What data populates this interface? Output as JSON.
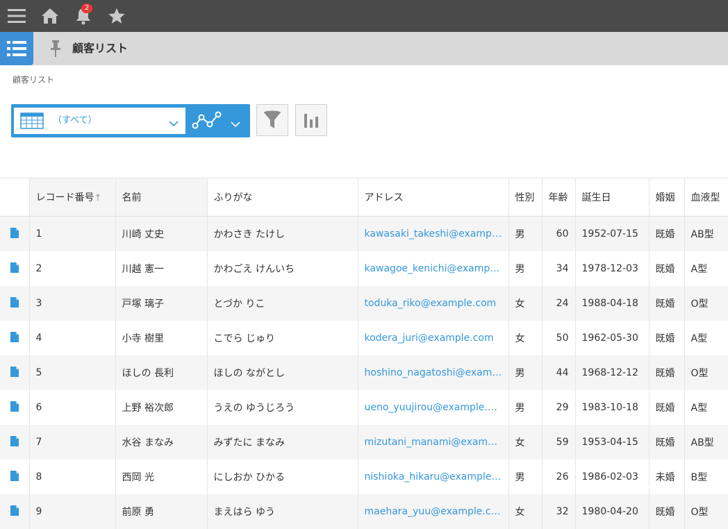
{
  "topbar": {
    "notification_count": "2",
    "icons": [
      "menu-icon",
      "home-icon",
      "bell-icon",
      "star-icon"
    ],
    "background": "#4a4a4a"
  },
  "app": {
    "title": "顧客リスト",
    "breadcrumb": "顧客リスト",
    "accent": "#3498db"
  },
  "view": {
    "selected": "（すべて）"
  },
  "table": {
    "headers": [
      "レコード番号",
      "名前",
      "ふりがな",
      "アドレス",
      "性別",
      "年齢",
      "誕生日",
      "婚姻",
      "血液型"
    ],
    "sort_arrow": "↑",
    "rows": [
      {
        "id": "1",
        "name": "川崎 丈史",
        "kana": "かわさき たけし",
        "email": "kawasaki_takeshi@example.com",
        "sex": "男",
        "age": "60",
        "birth": "1952-07-15",
        "marital": "既婚",
        "blood": "AB型"
      },
      {
        "id": "2",
        "name": "川越 憲一",
        "kana": "かわごえ けんいち",
        "email": "kawagoe_kenichi@example.com",
        "sex": "男",
        "age": "34",
        "birth": "1978-12-03",
        "marital": "既婚",
        "blood": "A型"
      },
      {
        "id": "3",
        "name": "戸塚 璃子",
        "kana": "とづか りこ",
        "email": "toduka_riko@example.com",
        "sex": "女",
        "age": "24",
        "birth": "1988-04-18",
        "marital": "既婚",
        "blood": "O型"
      },
      {
        "id": "4",
        "name": "小寺 樹里",
        "kana": "こでら じゅり",
        "email": "kodera_juri@example.com",
        "sex": "女",
        "age": "50",
        "birth": "1962-05-30",
        "marital": "既婚",
        "blood": "A型"
      },
      {
        "id": "5",
        "name": "ほしの 長利",
        "kana": "ほしの ながとし",
        "email": "hoshino_nagatoshi@example.com",
        "sex": "男",
        "age": "44",
        "birth": "1968-12-12",
        "marital": "既婚",
        "blood": "O型"
      },
      {
        "id": "6",
        "name": "上野 裕次郎",
        "kana": "うえの ゆうじろう",
        "email": "ueno_yuujirou@example.com",
        "sex": "男",
        "age": "29",
        "birth": "1983-10-18",
        "marital": "既婚",
        "blood": "A型"
      },
      {
        "id": "7",
        "name": "水谷 まなみ",
        "kana": "みずたに まなみ",
        "email": "mizutani_manami@example.com",
        "sex": "女",
        "age": "59",
        "birth": "1953-04-15",
        "marital": "既婚",
        "blood": "AB型"
      },
      {
        "id": "8",
        "name": "西岡 光",
        "kana": "にしおか ひかる",
        "email": "nishioka_hikaru@example.com",
        "sex": "男",
        "age": "26",
        "birth": "1986-02-03",
        "marital": "未婚",
        "blood": "B型"
      },
      {
        "id": "9",
        "name": "前原 勇",
        "kana": "まえはら ゆう",
        "email": "maehara_yuu@example.com",
        "sex": "女",
        "age": "32",
        "birth": "1980-04-20",
        "marital": "既婚",
        "blood": "O型"
      }
    ]
  }
}
